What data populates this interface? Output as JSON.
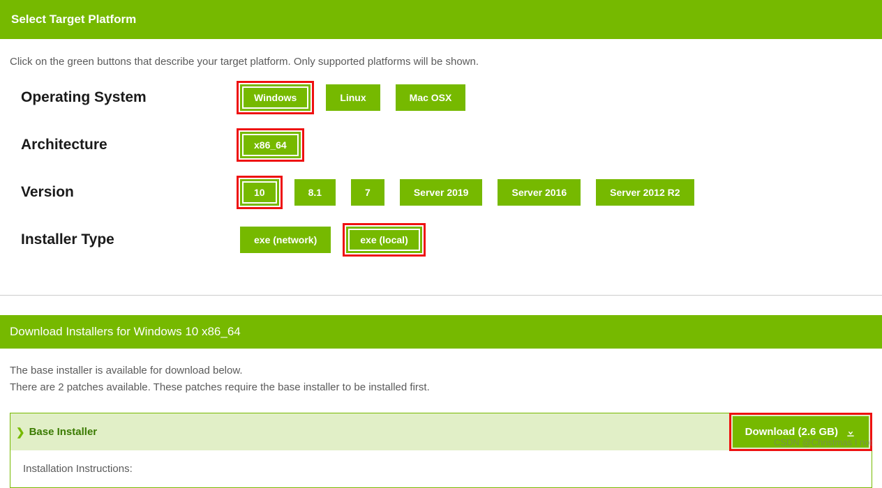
{
  "header": {
    "title": "Select Target Platform"
  },
  "instructions": "Click on the green buttons that describe your target platform. Only supported platforms will be shown.",
  "rows": {
    "os": {
      "label": "Operating System",
      "options": [
        {
          "label": "Windows",
          "highlighted": true,
          "selected": true
        },
        {
          "label": "Linux",
          "highlighted": false,
          "selected": false
        },
        {
          "label": "Mac OSX",
          "highlighted": false,
          "selected": false
        }
      ]
    },
    "arch": {
      "label": "Architecture",
      "options": [
        {
          "label": "x86_64",
          "highlighted": true,
          "selected": true
        }
      ]
    },
    "version": {
      "label": "Version",
      "options": [
        {
          "label": "10",
          "highlighted": true,
          "selected": true
        },
        {
          "label": "8.1",
          "highlighted": false,
          "selected": false
        },
        {
          "label": "7",
          "highlighted": false,
          "selected": false
        },
        {
          "label": "Server 2019",
          "highlighted": false,
          "selected": false
        },
        {
          "label": "Server 2016",
          "highlighted": false,
          "selected": false
        },
        {
          "label": "Server 2012 R2",
          "highlighted": false,
          "selected": false
        }
      ]
    },
    "installer": {
      "label": "Installer Type",
      "options": [
        {
          "label": "exe (network)",
          "highlighted": false,
          "selected": false
        },
        {
          "label": "exe (local)",
          "highlighted": true,
          "selected": true
        }
      ]
    }
  },
  "download_section": {
    "title": "Download Installers for Windows 10 x86_64",
    "note1": "The base installer is available for download below.",
    "note2": "There are 2 patches available. These patches require the base installer to be installed first.",
    "base_installer": {
      "label": "Base Installer",
      "download_label": "Download (2.6 GB)",
      "highlighted": true
    },
    "instructions_label": "Installation Instructions:"
  },
  "watermark": "CSDN @Christmas I not"
}
